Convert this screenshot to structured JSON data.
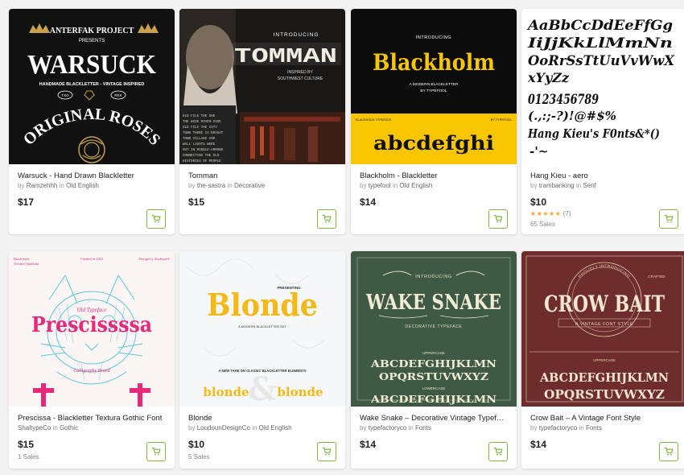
{
  "products": [
    {
      "title": "Warsuck - Hand Drawn Blackletter",
      "by": "by",
      "author": "Ramzehhh",
      "in": "in",
      "category": "Old English",
      "price": "$17",
      "thumb": {
        "brand_line": "ANTERFAK PROJECT",
        "presents": "PRESENTS",
        "headline": "WARSUCK",
        "tagline": "HANDMADE BLACKLETTER - VINTAGE INSPIRED",
        "badge_left": "TXO",
        "badge_right": "RKK",
        "arc_text": "ORIGINAL ROSES"
      }
    },
    {
      "title": "Tomman",
      "by": "by",
      "author": "the-sastra",
      "in": "in",
      "category": "Decorative",
      "price": "$15",
      "thumb": {
        "introducing": "INTRODUCING",
        "headline": "TOMMAN",
        "subtitle_1": "INSPIRED BY",
        "subtitle_2": "SOUTHWEST CULTURE"
      }
    },
    {
      "title": "Blackholm - Blackletter",
      "by": "by",
      "author": "typefool",
      "in": "in",
      "category": "Old English",
      "price": "$14",
      "thumb": {
        "introducing": "INTRODUCING",
        "headline": "Blackholm",
        "subtitle_1": "A MODERN BLACKLETTER",
        "subtitle_2": "BY TYPEFOOL",
        "corner_left": "BLACKHOLM TYPEFACE",
        "corner_right": "BY TYPEFOOL",
        "sample": "abcdefghi"
      }
    },
    {
      "title": "Hang Kieu - aero",
      "by": "by",
      "author": "trambanking",
      "in": "in",
      "category": "Serif",
      "price": "$10",
      "stars": "★★★★★",
      "rating_count": "(7)",
      "sales": "65 Sales",
      "thumb": {
        "line_1": "AaBbCcDdEeFfGg",
        "line_2": "IiJjKkLlMmNn",
        "line_3": "OoRrSsTtUuVvWwX",
        "line_4": "xYyZz",
        "line_5": "0123456789",
        "line_6": "(.,:;-?)!@#$%",
        "line_7": "Hang Kieu's F0nts&*()",
        "line_8": "-'~"
      }
    },
    {
      "title": "Prescissa - Blackletter Textura Gothic Font",
      "by": "by",
      "author": "ShaltypeCo",
      "in": "in",
      "category": "Gothic",
      "price": "$15",
      "sales": "1 Sales",
      "thumb": {
        "corner_left_1": "Blackletter",
        "corner_left_2": "Textura Quadrata",
        "corner_mid": "Created in 2021",
        "corner_right": "Design by Shaltype®",
        "typeface": "Old Typeface",
        "headline": "Prescissssa",
        "caption": "Calligraphy Brand"
      }
    },
    {
      "title": "Blonde",
      "by": "by",
      "author": "LoudounDesignCo",
      "in": "in",
      "category": "Old English",
      "price": "$10",
      "sales": "5 Sales",
      "thumb": {
        "presenting": "PRESENTING",
        "headline": "Blonde",
        "subtitle": "A MODERN BLACKLETTER SET",
        "tagline": "A NEW TAKE ON CLASSIC BLACKLETTER ELEMENTS",
        "sample_left": "blonde",
        "sample_right": "blonde"
      }
    },
    {
      "title": "Wake Snake – Decorative Vintage Typeface",
      "by": "by",
      "author": "typefactoryco",
      "in": "in",
      "category": "Fonts",
      "price": "$14",
      "thumb": {
        "introducing": "INTRODUCING",
        "headline": "WAKE SNAKE",
        "subtitle": "DECORATIVE TYPEFACE",
        "uppercase_label": "UPPERCASE",
        "upper_1": "ABCDEFGHIJKLMN",
        "upper_2": "OPQRSTUVWXYZ",
        "lowercase_label": "LOWERCASE",
        "lower_1": "ABCDEFGHIJKLMN"
      }
    },
    {
      "title": "Crow Bait – A Vintage Font Style",
      "by": "by",
      "author": "typefactoryco",
      "in": "in",
      "category": "Fonts",
      "price": "$14",
      "thumb": {
        "proudly": "PROUDLY INTRODUCING",
        "crafted": "CRAFTED",
        "headline": "CROW BAIT",
        "subtitle": "A VINTAGE FONT STYLE",
        "uppercase_label": "UPPERCASE",
        "upper_1": "ABCDEFGHIJKLMN",
        "upper_2": "OPQRSTUVWXYZ"
      }
    }
  ],
  "colors": {
    "accent": "#82b440",
    "star": "#f5a623",
    "blackholm_yellow": "#f7c600",
    "blonde_gold": "#f4b919",
    "prescissa_pink": "#e8287a",
    "wake_green": "#3e5a44",
    "crow_maroon": "#6e2d2c"
  },
  "icons": {
    "cart": "cart-icon"
  }
}
